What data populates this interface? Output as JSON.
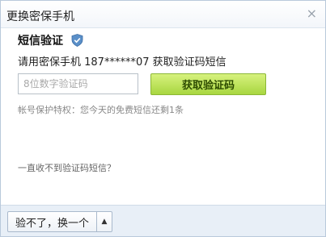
{
  "dialog": {
    "title": "更换密保手机",
    "close_label": "×"
  },
  "verification": {
    "heading": "短信验证",
    "instruction": "请用密保手机 187******07 获取验证码短信",
    "input_placeholder": "8位数字验证码",
    "input_value": "",
    "get_code_button": "获取验证码",
    "tip": "帐号保护特权：您今天的免费短信还剩1条",
    "no_sms_link": "一直收不到验证码短信？"
  },
  "footer": {
    "switch_button": "验不了，换一个",
    "arrow_glyph": "▲"
  },
  "colors": {
    "button_green_top": "#d7f27e",
    "button_green_bottom": "#a8d640",
    "shield_blue": "#5a8fc8",
    "footer_bg": "#e8eff7"
  },
  "icons": {
    "shield": "shield-check-icon",
    "close": "close-icon",
    "arrow": "arrow-up-icon"
  }
}
